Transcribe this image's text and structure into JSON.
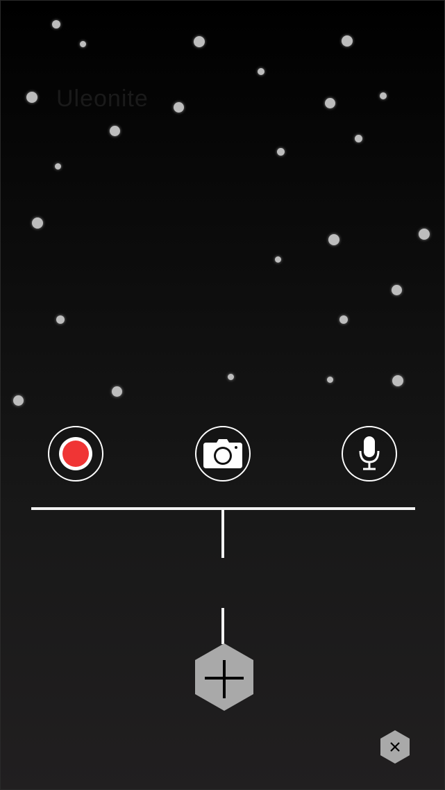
{
  "background": {
    "top_color": "#000000",
    "bottom_color": "#211f20"
  },
  "ghost_title": "Uleonite",
  "actions": {
    "record": {
      "icon": "record-icon",
      "ring_color": "#ffffff",
      "dot_color": "#f03535"
    },
    "camera": {
      "icon": "camera-icon"
    },
    "microphone": {
      "icon": "microphone-icon"
    }
  },
  "add_button": {
    "icon": "plus-icon",
    "fill": "#a9a9a9"
  },
  "close_button": {
    "icon": "close-icon",
    "fill": "#a9a9a9"
  },
  "decorations": {
    "icon": "snow-particles",
    "color": "#bdbdbd"
  }
}
